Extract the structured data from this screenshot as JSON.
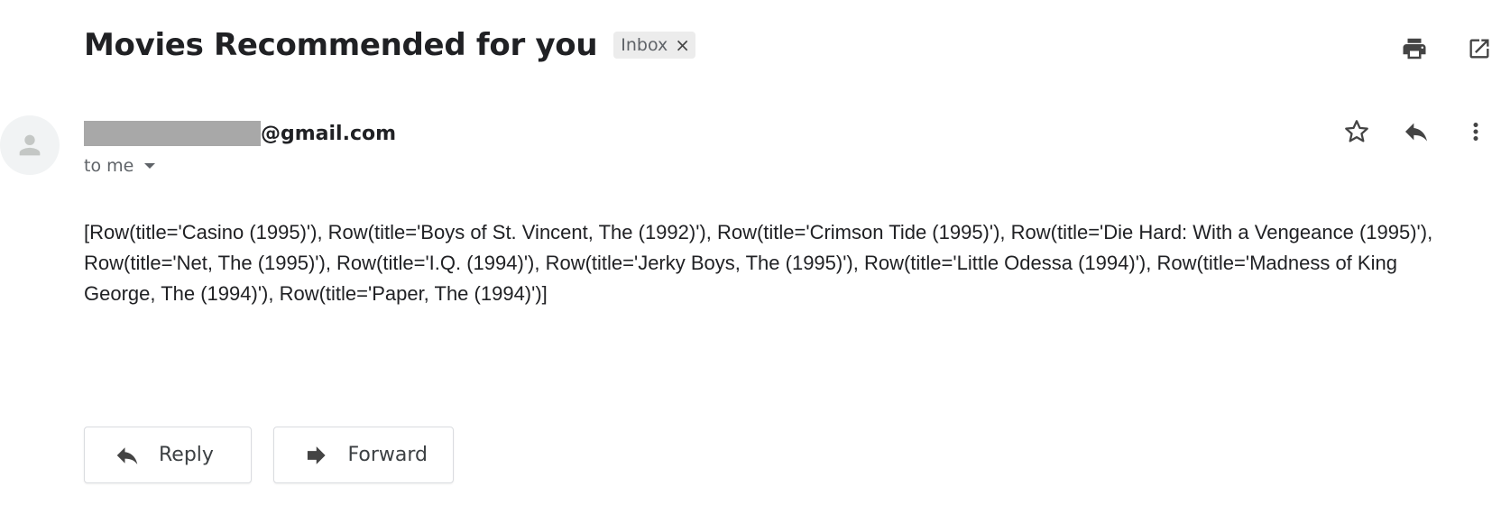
{
  "email": {
    "subject": "Movies Recommended for you",
    "label": "Inbox",
    "label_remove": "×",
    "sender_visible": "@gmail.com",
    "recipient": "to me",
    "body": "[Row(title='Casino (1995)'), Row(title='Boys of St. Vincent, The (1992)'), Row(title='Crimson Tide (1995)'), Row(title='Die Hard: With a Vengeance (1995)'), Row(title='Net, The (1995)'), Row(title='I.Q. (1994)'), Row(title='Jerky Boys, The (1995)'), Row(title='Little Odessa (1994)'), Row(title='Madness of King George, The (1994)'), Row(title='Paper, The (1994)')]"
  },
  "actions": {
    "reply_label": "Reply",
    "forward_label": "Forward"
  },
  "icons": {
    "print": "print-icon",
    "open_new_window": "open-in-new-window-icon",
    "star": "star-icon",
    "reply": "reply-icon",
    "more": "more-vert-icon",
    "avatar": "person-icon"
  },
  "colors": {
    "text": "#202124",
    "secondary": "#5f6368",
    "chip_bg": "#ececec",
    "avatar_bg": "#f1f3f4",
    "border": "#dadce0",
    "redaction": "#a8a8a8"
  }
}
